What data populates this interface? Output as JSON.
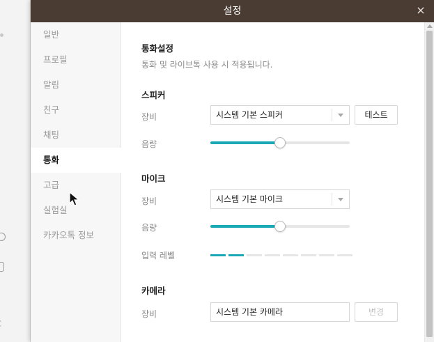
{
  "dialog": {
    "title": "설정",
    "close_label": "×"
  },
  "sidebar": {
    "items": [
      {
        "label": "일반",
        "active": false
      },
      {
        "label": "프로필",
        "active": false
      },
      {
        "label": "알림",
        "active": false
      },
      {
        "label": "친구",
        "active": false
      },
      {
        "label": "채팅",
        "active": false
      },
      {
        "label": "통화",
        "active": true
      },
      {
        "label": "고급",
        "active": false
      },
      {
        "label": "실험실",
        "active": false
      },
      {
        "label": "카카오톡 정보",
        "active": false
      }
    ]
  },
  "call_settings": {
    "title": "통화설정",
    "description": "통화 및 라이브톡 사용 시 적용됩니다."
  },
  "speaker": {
    "title": "스피커",
    "device_label": "장비",
    "device_value": "시스템 기본 스피커",
    "test_button": "테스트",
    "volume_label": "음량",
    "volume": 0.5
  },
  "mic": {
    "title": "마이크",
    "device_label": "장비",
    "device_value": "시스템 기본 마이크",
    "volume_label": "음량",
    "volume": 0.5,
    "input_level_label": "입력 레벨",
    "input_level_segments": 8,
    "input_level_active": 2
  },
  "camera": {
    "title": "카메라",
    "device_label": "장비",
    "device_value": "시스템 기본 카메라",
    "change_button": "변경",
    "change_enabled": false
  },
  "colors": {
    "titlebar": "#4a3c33",
    "accent": "#1ba8b6",
    "sidebar_bg": "#f7f7f7"
  }
}
